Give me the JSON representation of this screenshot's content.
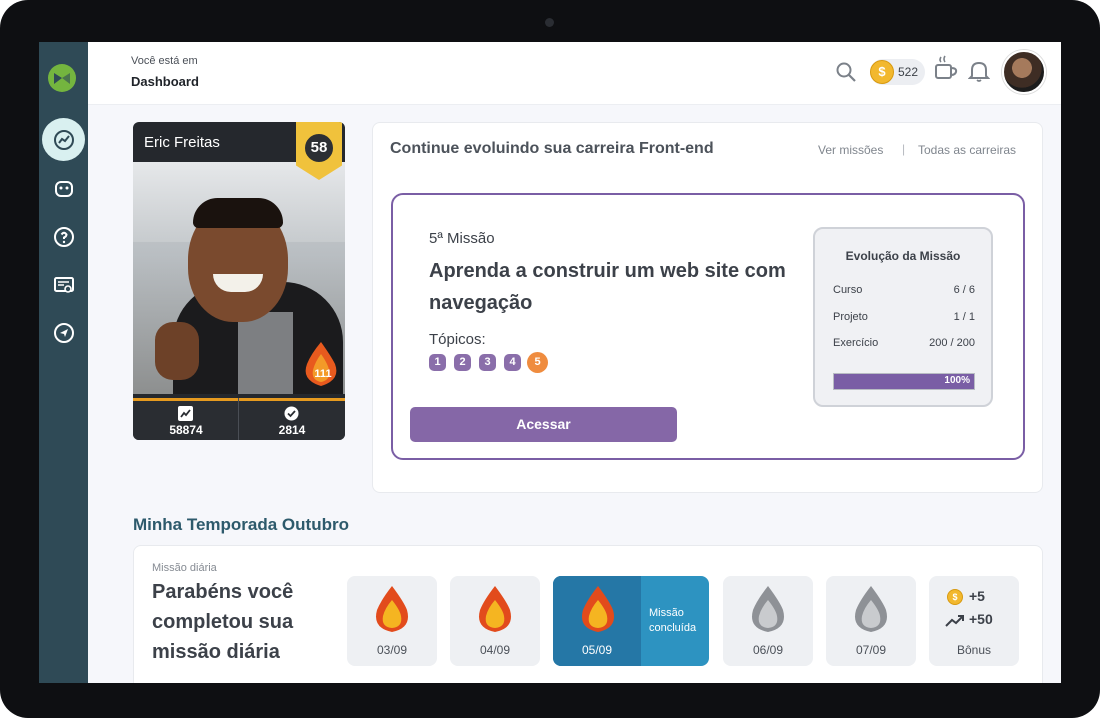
{
  "header": {
    "breadcrumb_prefix": "Você está em",
    "page_title": "Dashboard",
    "coins": "522",
    "coin_symbol": "$"
  },
  "profile": {
    "name": "Eric Freitas",
    "level": "58",
    "streak": "111",
    "stats": [
      {
        "icon": "trending-up-icon",
        "value": "58874"
      },
      {
        "icon": "check-circle-icon",
        "value": "2814"
      }
    ]
  },
  "career": {
    "title": "Continue evoluindo sua carreira Front-end",
    "links": [
      "Ver missões",
      "Todas as carreiras"
    ],
    "separator": "|",
    "mission": {
      "number": "5ª Missão",
      "title": "Aprenda a construir um web site com navegação",
      "topics_label": "Tópicos:",
      "topics": [
        "1",
        "2",
        "3",
        "4",
        "5"
      ],
      "current_topic": "5",
      "cta": "Acessar"
    },
    "evolution": {
      "title": "Evolução da Missão",
      "rows": [
        {
          "label": "Curso",
          "value": "6 / 6"
        },
        {
          "label": "Projeto",
          "value": "1 / 1"
        },
        {
          "label": "Exercício",
          "value": "200 / 200"
        }
      ],
      "progress_label": "100%",
      "progress_fraction": 1.0
    }
  },
  "season": {
    "title": "Minha Temporada Outubro",
    "daily_label": "Missão diária",
    "daily_message": "Parabéns você completou sua missão diária",
    "days": [
      {
        "date": "03/09",
        "status": "done"
      },
      {
        "date": "04/09",
        "status": "done"
      },
      {
        "date": "05/09",
        "status": "today"
      },
      {
        "date": "06/09",
        "status": "pending"
      },
      {
        "date": "07/09",
        "status": "pending"
      }
    ],
    "today_message": "Missão concluída",
    "bonus": {
      "coins": "+5",
      "xp": "+50",
      "label": "Bônus"
    }
  },
  "colors": {
    "sidebar": "#2f4a56",
    "accent_purple": "#8567a7",
    "accent_orange": "#ef8c3f",
    "active_day": "#2577a6",
    "season_title": "#2d5a6c"
  }
}
